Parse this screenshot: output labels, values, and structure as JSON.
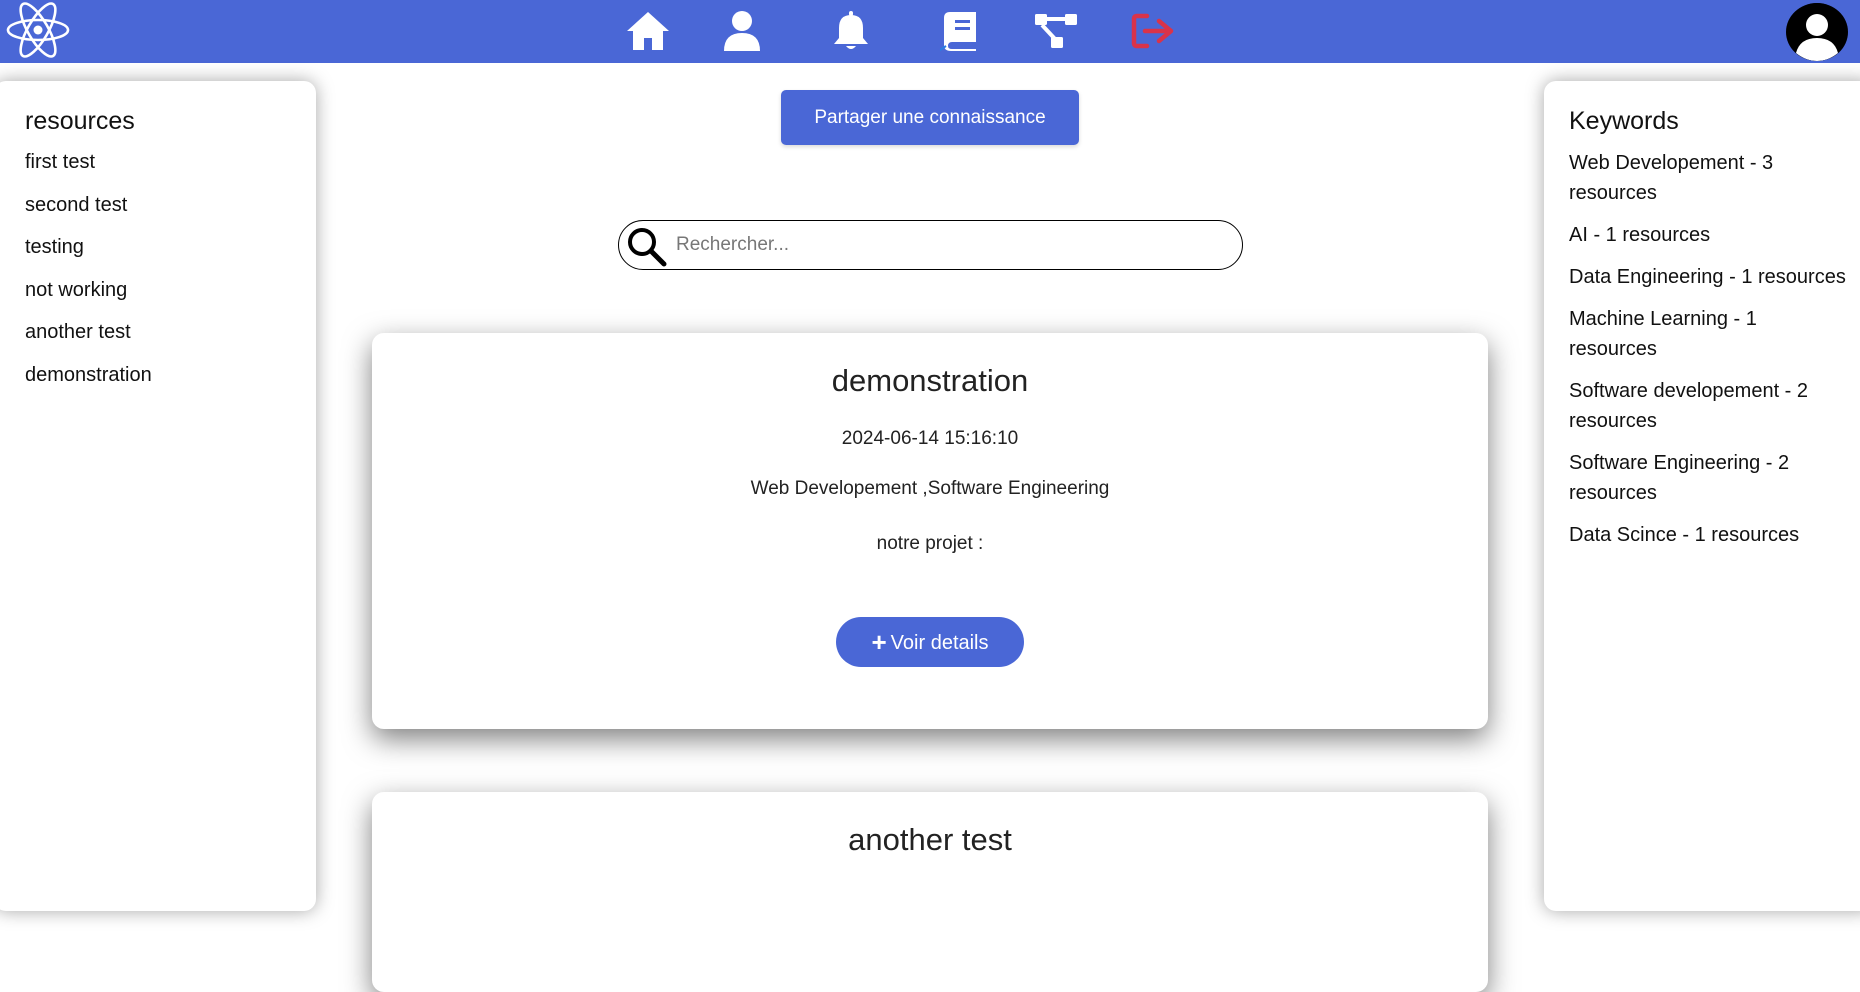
{
  "topbar": {
    "background": "#4a67d6",
    "icons": [
      "atom-logo-icon",
      "home-icon",
      "user-icon",
      "bell-icon",
      "book-icon",
      "sitemap-icon",
      "logout-icon",
      "avatar-icon"
    ],
    "logout_color": "#d9334a"
  },
  "resources": {
    "title": "resources",
    "items": [
      "first test",
      "second test",
      "testing",
      "not working",
      "another test",
      "demonstration"
    ]
  },
  "keywords": {
    "title": "Keywords",
    "items": [
      "Web Developement - 3 resources",
      "AI - 1 resources",
      "Data Engineering - 1 resources",
      "Machine Learning - 1 resources",
      "Software developement - 2 resources",
      "Software Engineering - 2 resources",
      "Data Scince - 1 resources"
    ]
  },
  "share_button": "Partager une connaissance",
  "search": {
    "placeholder": "Rechercher..."
  },
  "cards": [
    {
      "title": "demonstration",
      "date": "2024-06-14 15:16:10",
      "keywords": "Web Developement ,Software Engineering",
      "description": "notre projet :",
      "details_label": "Voir details"
    },
    {
      "title": "another test"
    }
  ]
}
